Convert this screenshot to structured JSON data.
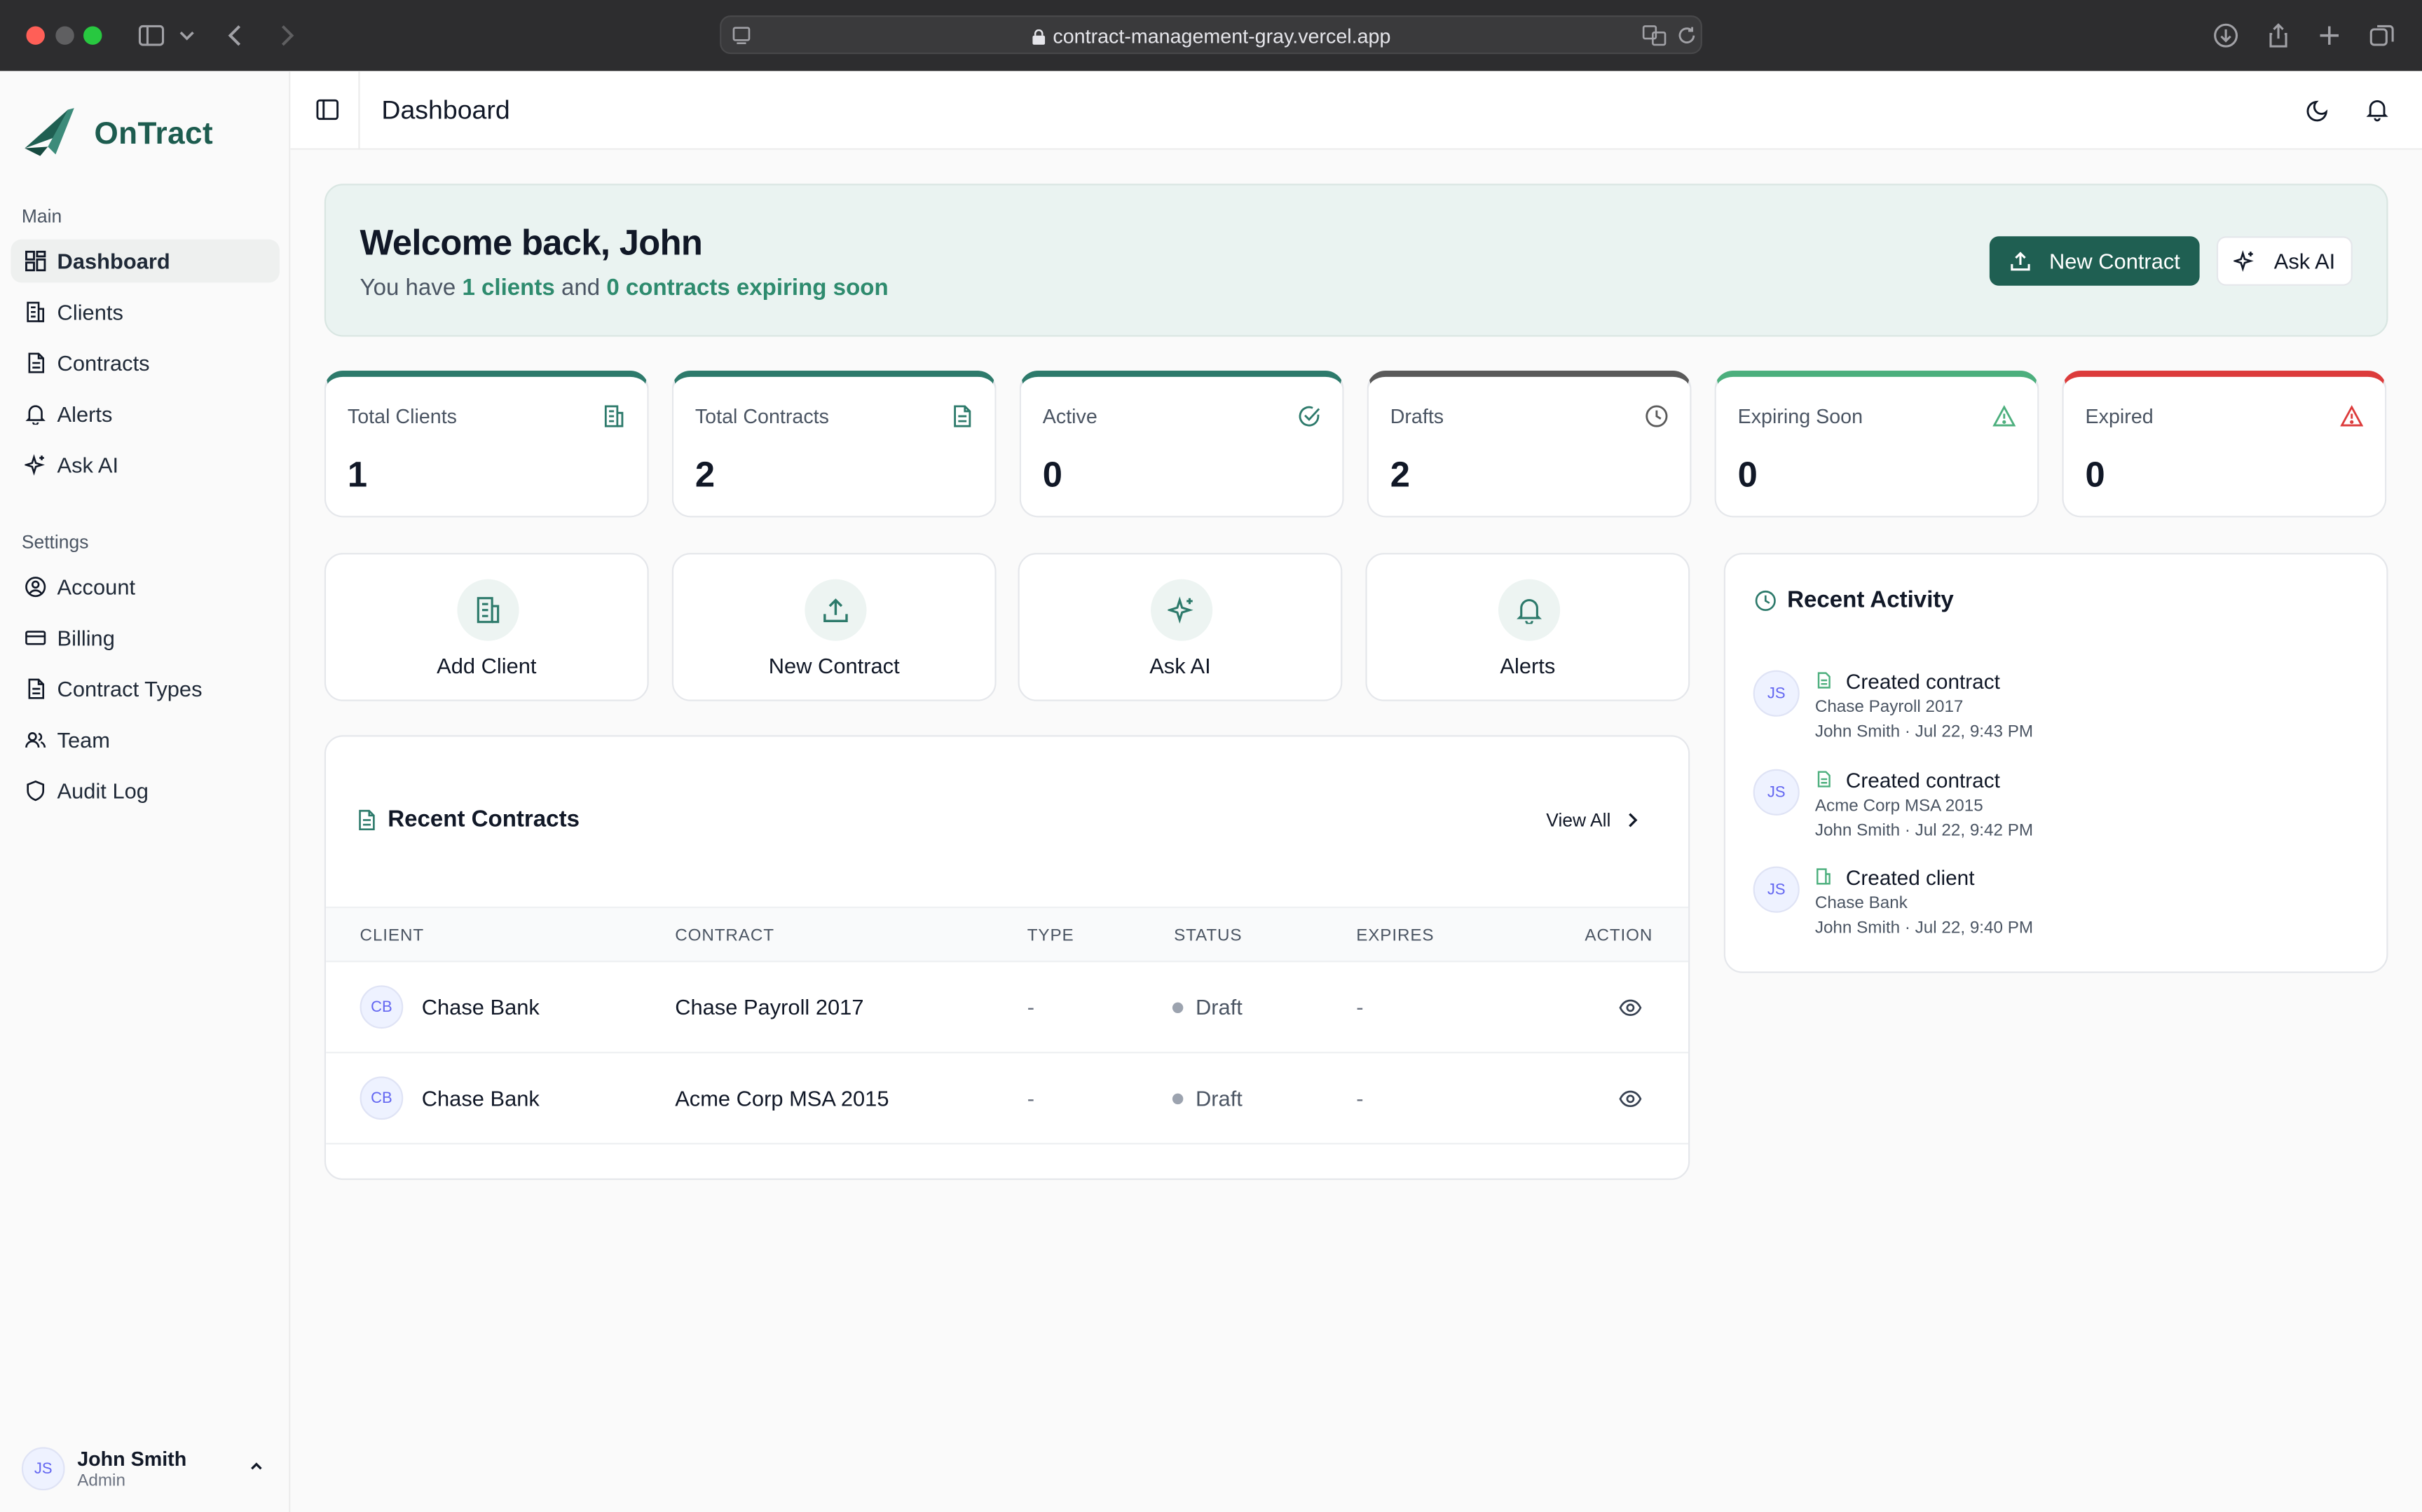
{
  "browser": {
    "url": "contract-management-gray.vercel.app"
  },
  "brand": {
    "name": "OnTract",
    "color": "#1d5c4f"
  },
  "sidebar": {
    "main_label": "Main",
    "main_items": [
      {
        "label": "Dashboard",
        "icon": "grid-icon",
        "active": true
      },
      {
        "label": "Clients",
        "icon": "building-icon"
      },
      {
        "label": "Contracts",
        "icon": "document-icon"
      },
      {
        "label": "Alerts",
        "icon": "bell-icon"
      },
      {
        "label": "Ask AI",
        "icon": "sparkle-icon"
      }
    ],
    "settings_label": "Settings",
    "settings_items": [
      {
        "label": "Account",
        "icon": "user-circle-icon"
      },
      {
        "label": "Billing",
        "icon": "credit-card-icon"
      },
      {
        "label": "Contract Types",
        "icon": "document-icon"
      },
      {
        "label": "Team",
        "icon": "users-icon"
      },
      {
        "label": "Audit Log",
        "icon": "shield-icon"
      }
    ],
    "user": {
      "initials": "JS",
      "name": "John Smith",
      "role": "Admin"
    }
  },
  "header": {
    "title": "Dashboard"
  },
  "welcome": {
    "title": "Welcome back, John",
    "sub_prefix": "You have ",
    "clients_text": "1 clients",
    "sub_middle": " and ",
    "contracts_text": "0 contracts expiring soon",
    "new_contract_label": "New Contract",
    "ask_ai_label": "Ask AI"
  },
  "stats": [
    {
      "label": "Total Clients",
      "value": "1",
      "icon": "building-icon",
      "accent": "#2d7a6b"
    },
    {
      "label": "Total Contracts",
      "value": "2",
      "icon": "document-icon",
      "accent": "#2d7a6b"
    },
    {
      "label": "Active",
      "value": "0",
      "icon": "check-circle-icon",
      "accent": "#2d7a6b"
    },
    {
      "label": "Drafts",
      "value": "2",
      "icon": "clock-icon",
      "accent": "#5a5a5a"
    },
    {
      "label": "Expiring Soon",
      "value": "0",
      "icon": "warning-icon",
      "accent": "#4caf7d"
    },
    {
      "label": "Expired",
      "value": "0",
      "icon": "alert-triangle-icon",
      "accent": "#dc3b3b"
    }
  ],
  "quick_actions": [
    {
      "label": "Add Client",
      "icon": "building-icon"
    },
    {
      "label": "New Contract",
      "icon": "upload-icon"
    },
    {
      "label": "Ask AI",
      "icon": "sparkle-icon"
    },
    {
      "label": "Alerts",
      "icon": "bell-icon"
    }
  ],
  "recent_contracts": {
    "title": "Recent Contracts",
    "view_all": "View All",
    "columns": [
      "CLIENT",
      "CONTRACT",
      "TYPE",
      "STATUS",
      "EXPIRES",
      "ACTION"
    ],
    "rows": [
      {
        "initials": "CB",
        "client": "Chase Bank",
        "contract": "Chase Payroll 2017",
        "type": "-",
        "status": "Draft",
        "expires": "-"
      },
      {
        "initials": "CB",
        "client": "Chase Bank",
        "contract": "Acme Corp MSA 2015",
        "type": "-",
        "status": "Draft",
        "expires": "-"
      }
    ]
  },
  "recent_activity": {
    "title": "Recent Activity",
    "items": [
      {
        "initials": "JS",
        "action": "Created contract",
        "subject": "Chase Payroll 2017",
        "meta": "John Smith · Jul 22, 9:43 PM",
        "icon": "document-icon"
      },
      {
        "initials": "JS",
        "action": "Created contract",
        "subject": "Acme Corp MSA 2015",
        "meta": "John Smith · Jul 22, 9:42 PM",
        "icon": "document-icon"
      },
      {
        "initials": "JS",
        "action": "Created client",
        "subject": "Chase Bank",
        "meta": "John Smith · Jul 22, 9:40 PM",
        "icon": "building-icon"
      }
    ]
  },
  "colors": {
    "primary": "#1f5f52",
    "highlight": "#2e8b6e",
    "welcome_bg": "#eaf3f1"
  }
}
